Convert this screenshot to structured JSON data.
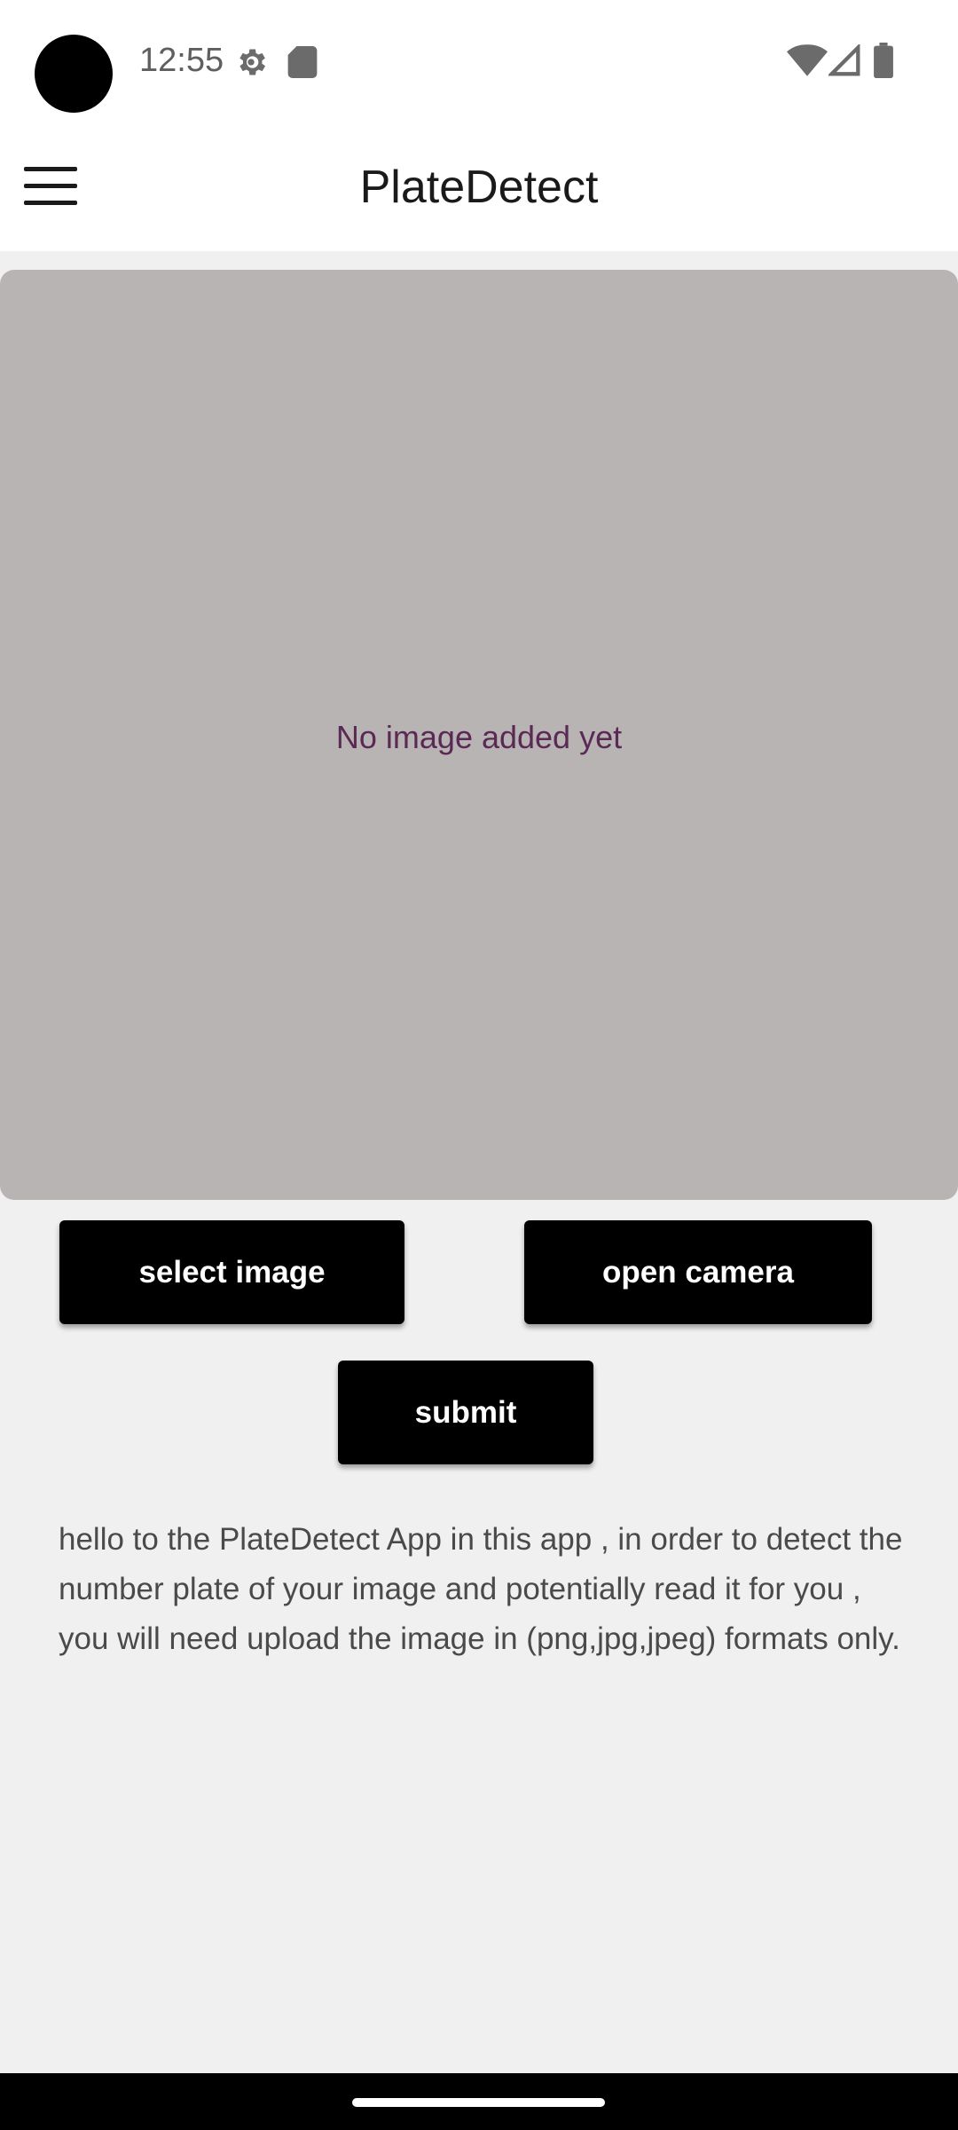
{
  "status_bar": {
    "time": "12:55",
    "icons": [
      "settings-gear-icon",
      "sd-card-icon",
      "wifi-icon",
      "cell-signal-icon",
      "battery-icon"
    ]
  },
  "app_bar": {
    "title": "PlateDetect",
    "menu_icon": "hamburger-menu-icon"
  },
  "preview": {
    "placeholder": "No image added yet",
    "background_color": "#b8b4b4",
    "placeholder_color": "#5a2a55"
  },
  "actions": {
    "select_image_label": "select image",
    "open_camera_label": "open camera",
    "submit_label": "submit"
  },
  "description": {
    "text": "hello to the PlateDetect App in this app , in order to detect the number plate of your image and potentially read it for you , you will need upload the image in (png,jpg,jpeg) formats only."
  },
  "colors": {
    "page_background": "#f0f0f0",
    "app_bar_background": "#ffffff",
    "button_background": "#000000",
    "button_text": "#ffffff"
  }
}
